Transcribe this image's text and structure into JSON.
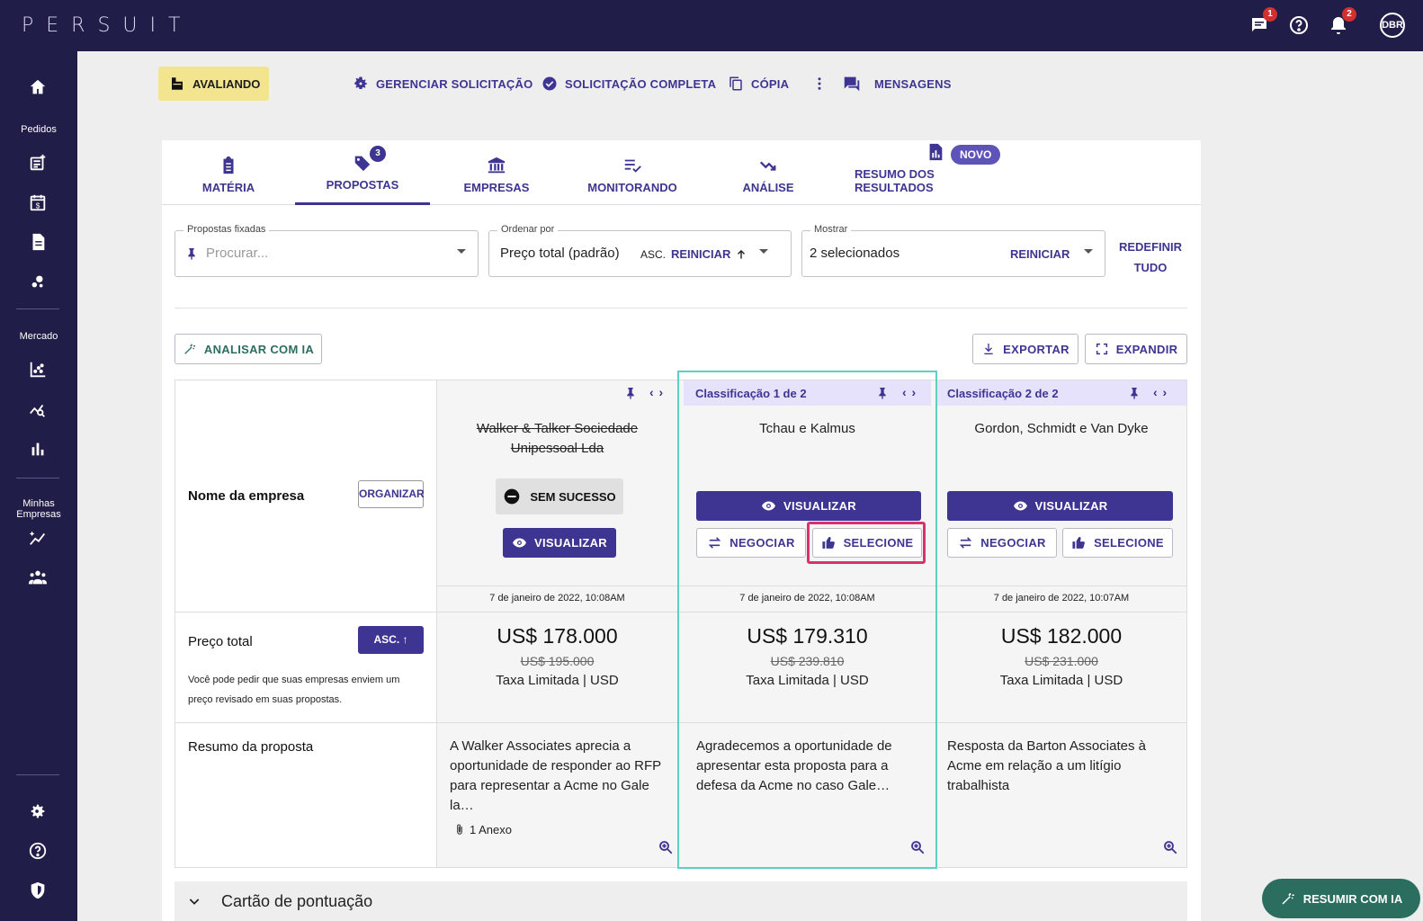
{
  "app": {
    "logo": "PERSUIT",
    "avatar": "DBR",
    "messages_count": "1",
    "notifications_count": "2"
  },
  "sidebar": {
    "section_pedidos": "Pedidos",
    "section_mercado": "Mercado",
    "section_minhas": "Minhas Empresas"
  },
  "actions": {
    "status": "AVALIANDO",
    "manage": "GERENCIAR SOLICITAÇÃO",
    "complete": "SOLICITAÇÃO COMPLETA",
    "copy": "CÓPIA",
    "messages": "MENSAGENS"
  },
  "tabs": [
    {
      "label": "MATÉRIA"
    },
    {
      "label": "PROPOSTAS",
      "badge": "3"
    },
    {
      "label": "EMPRESAS"
    },
    {
      "label": "MONITORANDO"
    },
    {
      "label": "ANÁLISE"
    },
    {
      "label": "RESUMO DOS RESULTADOS",
      "badge": "NOVO"
    }
  ],
  "filters": {
    "pinned_label": "Propostas fixadas",
    "pinned_placeholder": "Procurar...",
    "order_label": "Ordenar por",
    "order_value": "Preço total (padrão)",
    "order_dir": "ASC.",
    "order_reset": "REINICIAR",
    "show_label": "Mostrar",
    "show_value": "2 selecionados",
    "show_reset": "REINICIAR",
    "reset_all_1": "REDEFINIR",
    "reset_all_2": "TUDO"
  },
  "toolbar": {
    "analyze": "ANALISAR COM IA",
    "export": "EXPORTAR",
    "expand": "EXPANDIR"
  },
  "left_column": {
    "company_label": "Nome da empresa",
    "organize": "ORGANIZAR",
    "price_label": "Preço total",
    "price_sort": "ASC. ↑",
    "price_note": "Você pode pedir que suas empresas enviem um preço revisado em suas propostas.",
    "summary_label": "Resumo da proposta"
  },
  "proposals": [
    {
      "rank": "",
      "company": "Walker & Talker Sociedade Unipessoal Lda",
      "status": "SEM SUCESSO",
      "view": "VISUALIZAR",
      "date": "7 de janeiro de 2022, 10:08AM",
      "price": "US$ 178.000",
      "old_price": "US$ 195.000",
      "rate": "Taxa Limitada | USD",
      "summary": "A Walker Associates aprecia a oportunidade de responder ao RFP para representar a Acme no Gale la…",
      "attachment": "1 Anexo"
    },
    {
      "rank": "Classificação 1 de 2",
      "company": "Tchau e Kalmus",
      "view": "VISUALIZAR",
      "negotiate": "NEGOCIAR",
      "select": "SELECIONE",
      "date": "7 de janeiro de 2022, 10:08AM",
      "price": "US$ 179.310",
      "old_price": "US$ 239.810",
      "rate": "Taxa Limitada | USD",
      "summary": "Agradecemos a oportunidade de apresentar esta proposta para a defesa da Acme no caso Gale…"
    },
    {
      "rank": "Classificação 2 de 2",
      "company": "Gordon, Schmidt e Van Dyke",
      "view": "VISUALIZAR",
      "negotiate": "NEGOCIAR",
      "select": "SELECIONE",
      "date": "7 de janeiro de 2022, 10:07AM",
      "price": "US$ 182.000",
      "old_price": "US$ 231.000",
      "rate": "Taxa Limitada | USD",
      "summary": "Resposta da Barton Associates à Acme em relação a um litígio trabalhista"
    }
  ],
  "scorecard": "Cartão de pontuação",
  "fab": "RESUMIR COM IA",
  "colors": {
    "primary": "#3d3591",
    "nav": "#201d48",
    "status_chip": "#f3e48f",
    "highlight_col": "#5fcfc4",
    "highlight_btn": "#d6336c",
    "fab": "#2b6e60"
  }
}
